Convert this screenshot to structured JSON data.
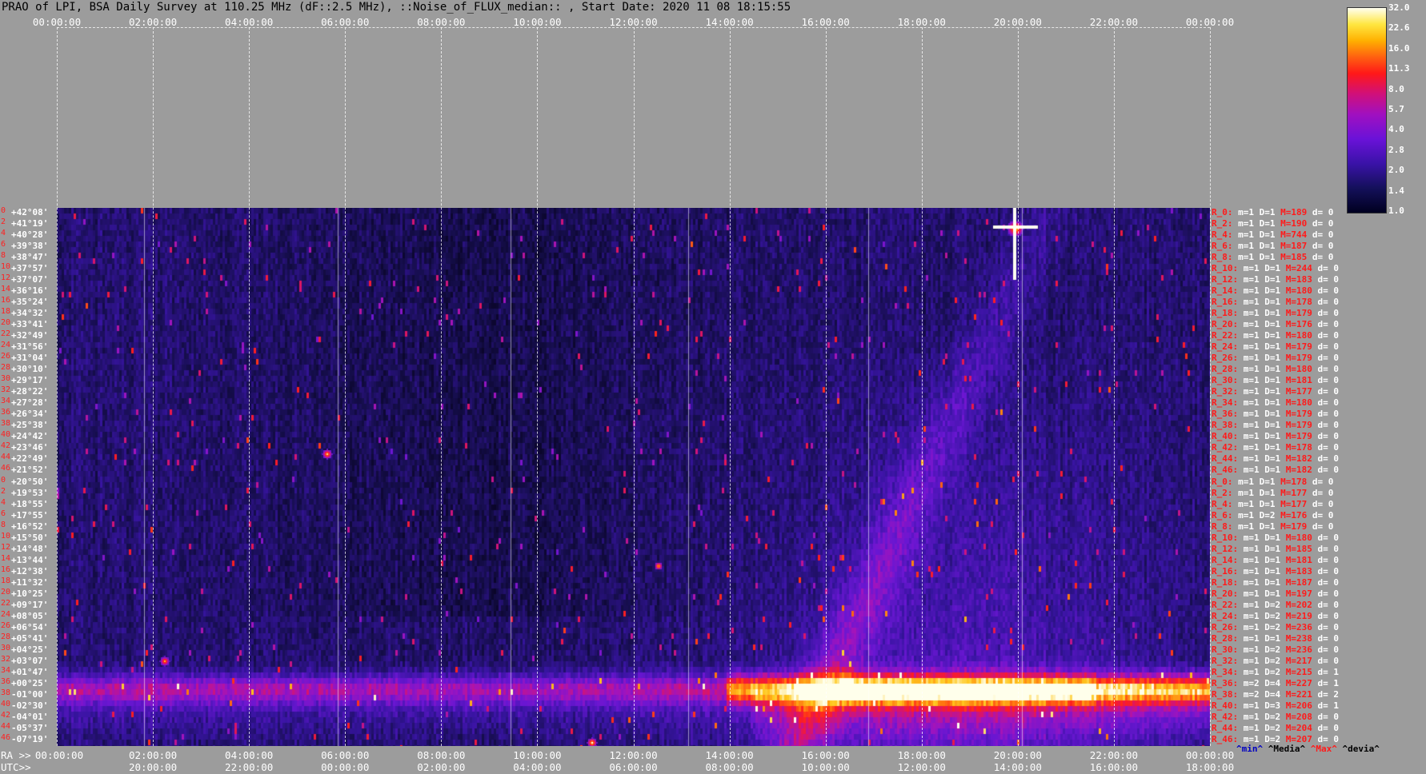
{
  "title": "PRAO of LPI, BSA Daily Survey at 110.25 MHz (dF::2.5 MHz), ::Noise_of_FLUX_median:: , Start Date: 2020 11 08 18:15:55",
  "top_axis_ticks": [
    "00:00:00",
    "02:00:00",
    "04:00:00",
    "06:00:00",
    "08:00:00",
    "10:00:00",
    "12:00:00",
    "14:00:00",
    "16:00:00",
    "18:00:00",
    "20:00:00",
    "22:00:00",
    "00:00:00"
  ],
  "bottom_ra_label": "RA >>",
  "bottom_ra_ticks": [
    "00:00:00",
    "02:00:00",
    "04:00:00",
    "06:00:00",
    "08:00:00",
    "10:00:00",
    "12:00:00",
    "14:00:00",
    "16:00:00",
    "18:00:00",
    "20:00:00",
    "22:00:00",
    "00:00:00"
  ],
  "bottom_utc_label": "UTC>>",
  "bottom_utc_ticks": [
    "20:00:00",
    "22:00:00",
    "00:00:00",
    "02:00:00",
    "04:00:00",
    "06:00:00",
    "08:00:00",
    "10:00:00",
    "12:00:00",
    "14:00:00",
    "16:00:00",
    "18:00:00"
  ],
  "colorbar": {
    "ticks": [
      "32.0",
      "22.6",
      "16.0",
      "11.3",
      "8.0",
      "5.7",
      "4.0",
      "2.8",
      "2.0",
      "1.4",
      "1.0"
    ]
  },
  "declinations": [
    "+42°08'",
    "+41°19'",
    "+40°28'",
    "+39°38'",
    "+38°47'",
    "+37°57'",
    "+37°07'",
    "+36°16'",
    "+35°24'",
    "+34°32'",
    "+33°41'",
    "+32°49'",
    "+31°56'",
    "+31°04'",
    "+30°10'",
    "+29°17'",
    "+28°22'",
    "+27°28'",
    "+26°34'",
    "+25°38'",
    "+24°42'",
    "+23°46'",
    "+22°49'",
    "+21°52'",
    "+20°50'",
    "+19°53'",
    "+18°55'",
    "+17°55'",
    "+16°52'",
    "+15°50'",
    "+14°48'",
    "+13°44'",
    "+12°38'",
    "+11°32'",
    "+10°25'",
    "+09°17'",
    "+08°05'",
    "+06°54'",
    "+05°41'",
    "+04°25'",
    "+03°07'",
    "+01°47'",
    "+00°25'",
    "-01°00'",
    "-02°30'",
    "-04°01'",
    "-05°37'",
    "-07°19'"
  ],
  "row_numbers": [
    "0",
    "2",
    "4",
    "6",
    "8",
    "10",
    "12",
    "14",
    "16",
    "18",
    "20",
    "22",
    "24",
    "26",
    "28",
    "30",
    "32",
    "34",
    "36",
    "38",
    "40",
    "42",
    "44",
    "46",
    "0",
    "2",
    "4",
    "6",
    "8",
    "10",
    "12",
    "14",
    "16",
    "18",
    "20",
    "22",
    "24",
    "26",
    "28",
    "30",
    "32",
    "34",
    "36",
    "38",
    "40",
    "42",
    "44",
    "46"
  ],
  "right_stats": [
    {
      "r": "R_0:",
      "m": "m=1",
      "D": "D=1",
      "M": "M=189",
      "d": "d= 0"
    },
    {
      "r": "R_2:",
      "m": "m=1",
      "D": "D=1",
      "M": "M=190",
      "d": "d= 0"
    },
    {
      "r": "R_4:",
      "m": "m=1",
      "D": "D=1",
      "M": "M=744",
      "d": "d= 0"
    },
    {
      "r": "R_6:",
      "m": "m=1",
      "D": "D=1",
      "M": "M=187",
      "d": "d= 0"
    },
    {
      "r": "R_8:",
      "m": "m=1",
      "D": "D=1",
      "M": "M=185",
      "d": "d= 0"
    },
    {
      "r": "R_10:",
      "m": "m=1",
      "D": "D=1",
      "M": "M=244",
      "d": "d= 0"
    },
    {
      "r": "R_12:",
      "m": "m=1",
      "D": "D=1",
      "M": "M=183",
      "d": "d= 0"
    },
    {
      "r": "R_14:",
      "m": "m=1",
      "D": "D=1",
      "M": "M=180",
      "d": "d= 0"
    },
    {
      "r": "R_16:",
      "m": "m=1",
      "D": "D=1",
      "M": "M=178",
      "d": "d= 0"
    },
    {
      "r": "R_18:",
      "m": "m=1",
      "D": "D=1",
      "M": "M=179",
      "d": "d= 0"
    },
    {
      "r": "R_20:",
      "m": "m=1",
      "D": "D=1",
      "M": "M=176",
      "d": "d= 0"
    },
    {
      "r": "R_22:",
      "m": "m=1",
      "D": "D=1",
      "M": "M=180",
      "d": "d= 0"
    },
    {
      "r": "R_24:",
      "m": "m=1",
      "D": "D=1",
      "M": "M=179",
      "d": "d= 0"
    },
    {
      "r": "R_26:",
      "m": "m=1",
      "D": "D=1",
      "M": "M=179",
      "d": "d= 0"
    },
    {
      "r": "R_28:",
      "m": "m=1",
      "D": "D=1",
      "M": "M=180",
      "d": "d= 0"
    },
    {
      "r": "R_30:",
      "m": "m=1",
      "D": "D=1",
      "M": "M=181",
      "d": "d= 0"
    },
    {
      "r": "R_32:",
      "m": "m=1",
      "D": "D=1",
      "M": "M=177",
      "d": "d= 0"
    },
    {
      "r": "R_34:",
      "m": "m=1",
      "D": "D=1",
      "M": "M=180",
      "d": "d= 0"
    },
    {
      "r": "R_36:",
      "m": "m=1",
      "D": "D=1",
      "M": "M=179",
      "d": "d= 0"
    },
    {
      "r": "R_38:",
      "m": "m=1",
      "D": "D=1",
      "M": "M=179",
      "d": "d= 0"
    },
    {
      "r": "R_40:",
      "m": "m=1",
      "D": "D=1",
      "M": "M=179",
      "d": "d= 0"
    },
    {
      "r": "R_42:",
      "m": "m=1",
      "D": "D=1",
      "M": "M=178",
      "d": "d= 0"
    },
    {
      "r": "R_44:",
      "m": "m=1",
      "D": "D=1",
      "M": "M=182",
      "d": "d= 0"
    },
    {
      "r": "R_46:",
      "m": "m=1",
      "D": "D=1",
      "M": "M=182",
      "d": "d= 0"
    },
    {
      "r": "R_0:",
      "m": "m=1",
      "D": "D=1",
      "M": "M=178",
      "d": "d= 0"
    },
    {
      "r": "R_2:",
      "m": "m=1",
      "D": "D=1",
      "M": "M=177",
      "d": "d= 0"
    },
    {
      "r": "R_4:",
      "m": "m=1",
      "D": "D=1",
      "M": "M=177",
      "d": "d= 0"
    },
    {
      "r": "R_6:",
      "m": "m=1",
      "D": "D=2",
      "M": "M=176",
      "d": "d= 0"
    },
    {
      "r": "R_8:",
      "m": "m=1",
      "D": "D=1",
      "M": "M=179",
      "d": "d= 0"
    },
    {
      "r": "R_10:",
      "m": "m=1",
      "D": "D=1",
      "M": "M=180",
      "d": "d= 0"
    },
    {
      "r": "R_12:",
      "m": "m=1",
      "D": "D=1",
      "M": "M=185",
      "d": "d= 0"
    },
    {
      "r": "R_14:",
      "m": "m=1",
      "D": "D=1",
      "M": "M=181",
      "d": "d= 0"
    },
    {
      "r": "R_16:",
      "m": "m=1",
      "D": "D=1",
      "M": "M=183",
      "d": "d= 0"
    },
    {
      "r": "R_18:",
      "m": "m=1",
      "D": "D=1",
      "M": "M=187",
      "d": "d= 0"
    },
    {
      "r": "R_20:",
      "m": "m=1",
      "D": "D=1",
      "M": "M=197",
      "d": "d= 0"
    },
    {
      "r": "R_22:",
      "m": "m=1",
      "D": "D=2",
      "M": "M=202",
      "d": "d= 0"
    },
    {
      "r": "R_24:",
      "m": "m=1",
      "D": "D=2",
      "M": "M=219",
      "d": "d= 0"
    },
    {
      "r": "R_26:",
      "m": "m=1",
      "D": "D=2",
      "M": "M=236",
      "d": "d= 0"
    },
    {
      "r": "R_28:",
      "m": "m=1",
      "D": "D=1",
      "M": "M=238",
      "d": "d= 0"
    },
    {
      "r": "R_30:",
      "m": "m=1",
      "D": "D=2",
      "M": "M=236",
      "d": "d= 0"
    },
    {
      "r": "R_32:",
      "m": "m=1",
      "D": "D=2",
      "M": "M=217",
      "d": "d= 0"
    },
    {
      "r": "R_34:",
      "m": "m=1",
      "D": "D=2",
      "M": "M=215",
      "d": "d= 1"
    },
    {
      "r": "R_36:",
      "m": "m=2",
      "D": "D=4",
      "M": "M=227",
      "d": "d= 1"
    },
    {
      "r": "R_38:",
      "m": "m=2",
      "D": "D=4",
      "M": "M=221",
      "d": "d= 2"
    },
    {
      "r": "R_40:",
      "m": "m=1",
      "D": "D=3",
      "M": "M=206",
      "d": "d= 1"
    },
    {
      "r": "R_42:",
      "m": "m=1",
      "D": "D=2",
      "M": "M=208",
      "d": "d= 0"
    },
    {
      "r": "R_44:",
      "m": "m=1",
      "D": "D=2",
      "M": "M=204",
      "d": "d= 0"
    },
    {
      "r": "R_46:",
      "m": "m=1",
      "D": "D=2",
      "M": "M=207",
      "d": "d= 0"
    }
  ],
  "legend_footer": {
    "min": "^min^",
    "media": "^Media^",
    "max": "^Max^",
    "devia": "^devia^",
    "colors": {
      "min": "#0000c0",
      "media": "#000000",
      "max": "#ff1a1a",
      "devia": "#000000"
    }
  }
}
